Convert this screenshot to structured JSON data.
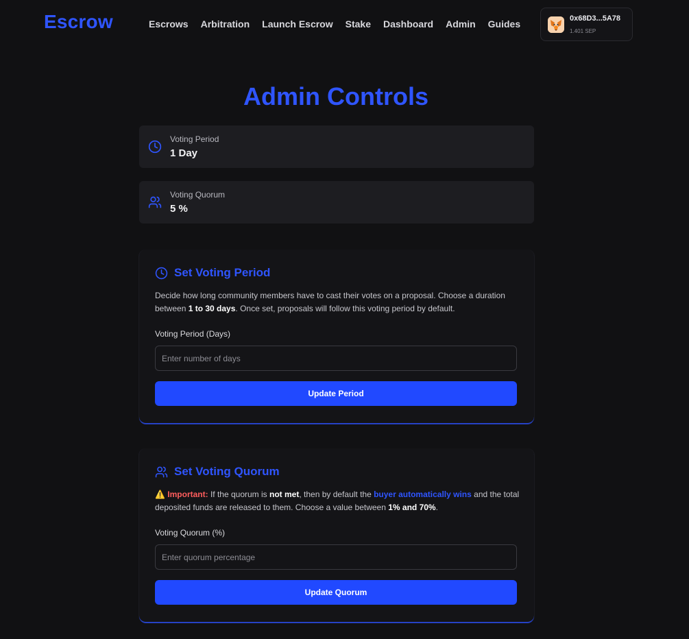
{
  "app": {
    "logo": "Escrow"
  },
  "nav": {
    "items": [
      {
        "label": "Escrows"
      },
      {
        "label": "Arbitration"
      },
      {
        "label": "Launch Escrow"
      },
      {
        "label": "Stake"
      },
      {
        "label": "Dashboard"
      },
      {
        "label": "Admin"
      },
      {
        "label": "Guides"
      }
    ]
  },
  "wallet": {
    "address": "0x68D3...5A78",
    "balance": "1.401 SEP",
    "icon": "metamask-fox-icon"
  },
  "page": {
    "title": "Admin Controls"
  },
  "stats": {
    "voting_period": {
      "label": "Voting Period",
      "value": "1 Day",
      "icon": "clock-icon"
    },
    "voting_quorum": {
      "label": "Voting Quorum",
      "value": "5 %",
      "icon": "users-icon"
    }
  },
  "period_card": {
    "title": "Set Voting Period",
    "icon": "clock-icon",
    "desc_1": "Decide how long community members have to cast their votes on a proposal. Choose a duration between ",
    "desc_bold": "1 to 30 days",
    "desc_2": ". Once set, proposals will follow this voting period by default.",
    "field_label": "Voting Period (Days)",
    "placeholder": "Enter number of days",
    "value": "",
    "button_label": "Update Period"
  },
  "quorum_card": {
    "title": "Set Voting Quorum",
    "icon": "users-icon",
    "warn_emoji": "⚠️",
    "warn_label": "Important:",
    "desc_1": " If the quorum is ",
    "desc_bold_1": "not met",
    "desc_2": ", then by default the ",
    "desc_blue": "buyer automatically wins",
    "desc_3": " and the total deposited funds are released to them. Choose a value between ",
    "desc_bold_2": "1% and 70%",
    "desc_4": ".",
    "field_label": "Voting Quorum (%)",
    "placeholder": "Enter quorum percentage",
    "value": "",
    "button_label": "Update Quorum"
  },
  "colors": {
    "accent": "#2f55ff",
    "button": "#2149ff",
    "background": "#111113",
    "card": "#1d1d21",
    "warning": "#ff5d5d"
  }
}
